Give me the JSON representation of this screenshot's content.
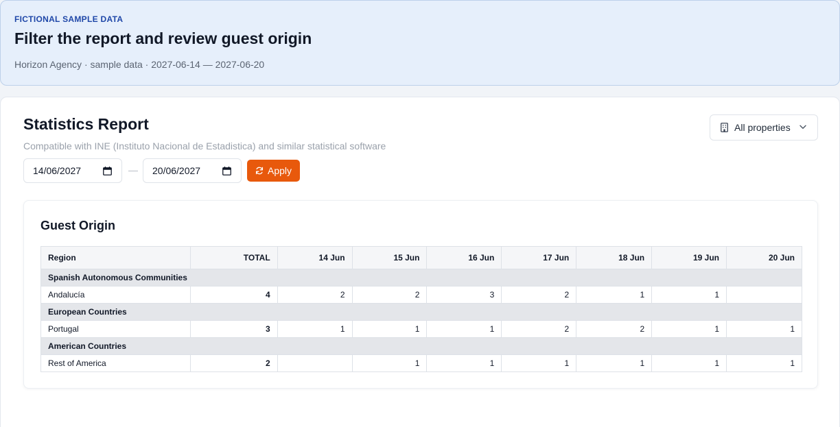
{
  "banner": {
    "tag": "FICTIONAL SAMPLE DATA",
    "title": "Filter the report and review guest origin",
    "subtitle": "Horizon Agency · sample data · 2027-06-14 — 2027-06-20"
  },
  "report": {
    "title": "Statistics Report",
    "subtitle": "Compatible with INE (Instituto Nacional de Estadistica) and similar statistical software",
    "property_select": "All properties",
    "date_from": "14/06/2027",
    "date_separator": "—",
    "date_to": "20/06/2027",
    "apply_label": "Apply"
  },
  "guest_origin": {
    "title": "Guest Origin",
    "columns": [
      "Region",
      "TOTAL",
      "14 Jun",
      "15 Jun",
      "16 Jun",
      "17 Jun",
      "18 Jun",
      "19 Jun",
      "20 Jun"
    ],
    "groups": [
      {
        "name": "Spanish Autonomous Communities",
        "rows": [
          {
            "region": "Andalucía",
            "total": "4",
            "days": [
              "2",
              "2",
              "3",
              "2",
              "1",
              "1",
              ""
            ]
          }
        ]
      },
      {
        "name": "European Countries",
        "rows": [
          {
            "region": "Portugal",
            "total": "3",
            "days": [
              "1",
              "1",
              "1",
              "2",
              "2",
              "1",
              "1"
            ]
          }
        ]
      },
      {
        "name": "American Countries",
        "rows": [
          {
            "region": "Rest of America",
            "total": "2",
            "days": [
              "",
              "1",
              "1",
              "1",
              "1",
              "1",
              "1"
            ]
          }
        ]
      }
    ]
  },
  "icons": {
    "property": "building-icon",
    "dropdown": "chevron-down-icon",
    "calendar": "calendar-icon",
    "apply": "refresh-icon"
  },
  "colors": {
    "accent": "#e8590c",
    "banner_bg": "#e6effb",
    "banner_tag": "#1f47a8",
    "group_row_bg": "#e4e6ea"
  }
}
